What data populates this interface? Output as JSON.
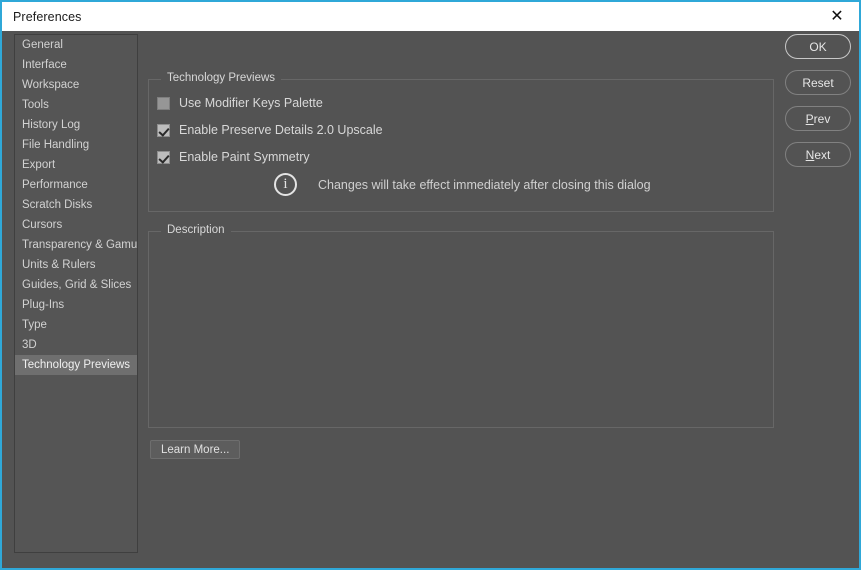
{
  "window": {
    "title": "Preferences",
    "close_icon": "close-icon",
    "accent_color": "#2fa8d8",
    "background_color": "#535353",
    "titlebar_color": "#ffffff"
  },
  "sidebar": {
    "selected": "Technology Previews",
    "items": [
      {
        "label": "General"
      },
      {
        "label": "Interface"
      },
      {
        "label": "Workspace"
      },
      {
        "label": "Tools"
      },
      {
        "label": "History Log"
      },
      {
        "label": "File Handling"
      },
      {
        "label": "Export"
      },
      {
        "label": "Performance"
      },
      {
        "label": "Scratch Disks"
      },
      {
        "label": "Cursors"
      },
      {
        "label": "Transparency & Gamut"
      },
      {
        "label": "Units & Rulers"
      },
      {
        "label": "Guides, Grid & Slices"
      },
      {
        "label": "Plug-Ins"
      },
      {
        "label": "Type"
      },
      {
        "label": "3D"
      },
      {
        "label": "Technology Previews"
      }
    ]
  },
  "tech_previews": {
    "legend": "Technology Previews",
    "options": [
      {
        "label": "Use Modifier Keys Palette",
        "checked": false
      },
      {
        "label": "Enable Preserve Details 2.0 Upscale",
        "checked": true
      },
      {
        "label": "Enable Paint Symmetry",
        "checked": true
      }
    ],
    "note": {
      "icon": "info-icon",
      "glyph": "i",
      "text": "Changes will take effect immediately after closing this dialog"
    }
  },
  "description": {
    "legend": "Description",
    "body": ""
  },
  "learn_more": {
    "label": "Learn More..."
  },
  "buttons": [
    {
      "label": "OK",
      "default": true
    },
    {
      "label": "Reset",
      "default": false
    },
    {
      "label": "Prev",
      "default": false
    },
    {
      "label": "Next",
      "default": false
    }
  ]
}
